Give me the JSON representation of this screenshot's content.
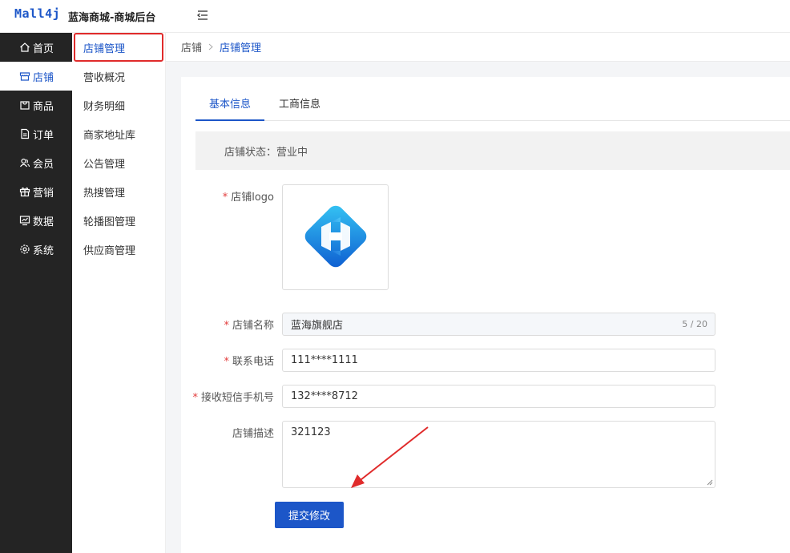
{
  "header": {
    "logo": "Mall4j",
    "title": "蓝海商城-商城后台"
  },
  "sidebar": {
    "items": [
      {
        "label": "首页",
        "icon": "home-icon"
      },
      {
        "label": "店铺",
        "icon": "shop-icon"
      },
      {
        "label": "商品",
        "icon": "product-icon"
      },
      {
        "label": "订单",
        "icon": "order-icon"
      },
      {
        "label": "会员",
        "icon": "member-icon"
      },
      {
        "label": "营销",
        "icon": "gift-icon"
      },
      {
        "label": "数据",
        "icon": "data-icon"
      },
      {
        "label": "系统",
        "icon": "settings-icon"
      }
    ]
  },
  "submenu": {
    "items": [
      {
        "label": "店铺管理"
      },
      {
        "label": "营收概况"
      },
      {
        "label": "财务明细"
      },
      {
        "label": "商家地址库"
      },
      {
        "label": "公告管理"
      },
      {
        "label": "热搜管理"
      },
      {
        "label": "轮播图管理"
      },
      {
        "label": "供应商管理"
      }
    ]
  },
  "breadcrumb": {
    "first": "店铺",
    "current": "店铺管理"
  },
  "tabs": [
    {
      "label": "基本信息"
    },
    {
      "label": "工商信息"
    }
  ],
  "status": {
    "text": "店铺状态：营业中"
  },
  "form": {
    "logo_label": "店铺logo",
    "name_label": "店铺名称",
    "name_value": "蓝海旗舰店",
    "name_counter": "5 / 20",
    "phone_label": "联系电话",
    "phone_value": "111****1111",
    "sms_label": "接收短信手机号",
    "sms_value": "132****8712",
    "desc_label": "店铺描述",
    "desc_value": "321123",
    "required_mark": "*",
    "submit_label": "提交修改"
  },
  "colors": {
    "brand": "#1c56c8",
    "annotation": "#e02b2b"
  }
}
